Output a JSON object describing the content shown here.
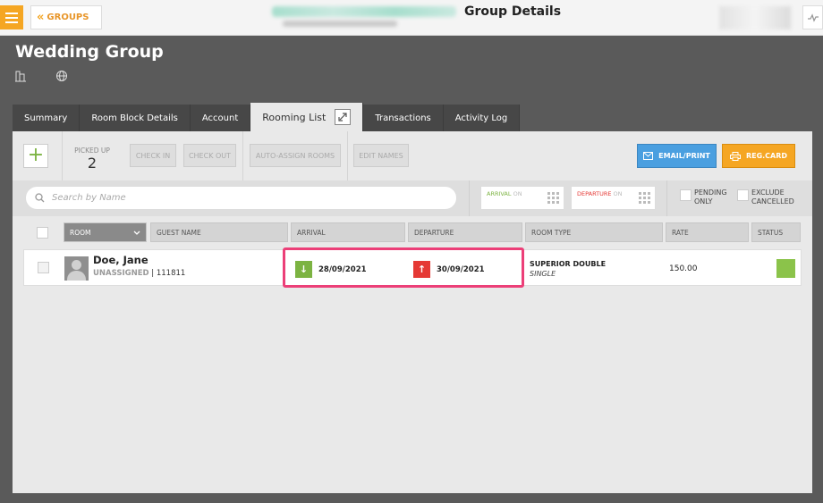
{
  "topbar": {
    "groups_label": "GROUPS",
    "page_title": "Group Details"
  },
  "header": {
    "group_name": "Wedding Group"
  },
  "tabs": [
    {
      "label": "Summary"
    },
    {
      "label": "Room Block Details"
    },
    {
      "label": "Account"
    },
    {
      "label": "Rooming List"
    },
    {
      "label": "Transactions"
    },
    {
      "label": "Activity Log"
    }
  ],
  "active_tab": "Rooming List",
  "toolbar": {
    "picked_up_label": "PICKED UP",
    "picked_up_value": "2",
    "check_in": "CHECK IN",
    "check_out": "CHECK OUT",
    "auto_assign": "AUTO-ASSIGN ROOMS",
    "edit_names": "EDIT NAMES",
    "email_print": "EMAIL/PRINT",
    "reg_card": "REG.CARD"
  },
  "filters": {
    "search_placeholder": "Search by Name",
    "arrival_label": "ARRIVAL",
    "arrival_on": "ON",
    "departure_label": "DEPARTURE",
    "departure_on": "ON",
    "pending_only": [
      "PENDING",
      "ONLY"
    ],
    "exclude_cancelled": [
      "EXCLUDE",
      "CANCELLED"
    ]
  },
  "columns": {
    "room": "ROOM",
    "guest_name": "GUEST NAME",
    "arrival": "ARRIVAL",
    "departure": "DEPARTURE",
    "room_type": "ROOM TYPE",
    "rate": "RATE",
    "status": "STATUS"
  },
  "rows": [
    {
      "guest_name": "Doe, Jane",
      "room_status": "UNASSIGNED",
      "confirmation": "| 111811",
      "arrival": "28/09/2021",
      "departure": "30/09/2021",
      "room_type": "SUPERIOR DOUBLE",
      "occupancy": "SINGLE",
      "rate": "150.00",
      "status_color": "#8bc34a"
    }
  ],
  "colors": {
    "accent_orange": "#f5a623",
    "email_blue": "#4a9fe0",
    "arrival_green": "#7cb342",
    "departure_red": "#e53935",
    "highlight_pink": "#ec3f78"
  }
}
